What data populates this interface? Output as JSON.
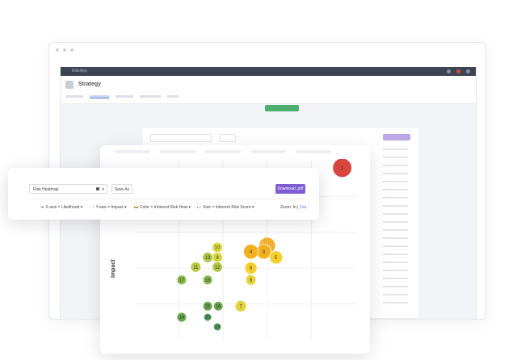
{
  "toolbar": {
    "heatmap_select": "Risk Heatmap",
    "save_as": "Save As",
    "download": "Download .pdf",
    "x_axis": "X-axis = Likelihood",
    "y_axis": "Y-axis = Impact",
    "color": "Color = Inherent Risk Heat",
    "size": "Size = Inherent Risk Score",
    "zoom_label": "Zoom:",
    "zoom_in": "In",
    "zoom_sep": "|",
    "zoom_out": "Out"
  },
  "background_window": {
    "topbar_title": "RiskApp",
    "page_title": "Strategy",
    "accent_color": "#4caf6d"
  },
  "chart_data": {
    "type": "scatter",
    "ylabel": "Impact",
    "xlabel": "",
    "grid": true,
    "x_range": [
      0,
      5
    ],
    "y_range": [
      0,
      5
    ],
    "points": [
      {
        "label": "1",
        "x": 4.7,
        "y": 4.8,
        "r": 2.2,
        "color": "#d9463f"
      },
      {
        "label": "2",
        "x": 3.0,
        "y": 2.63,
        "r": 1.9,
        "color": "#f0a92b",
        "pattern": true
      },
      {
        "label": "3",
        "x": 2.92,
        "y": 2.46,
        "r": 1.7,
        "color": "#f2b01e"
      },
      {
        "label": "4",
        "x": 2.63,
        "y": 2.46,
        "r": 1.7,
        "color": "#f2b01e"
      },
      {
        "label": "5",
        "x": 3.2,
        "y": 2.3,
        "r": 1.5,
        "color": "#f3d02c"
      },
      {
        "label": "6",
        "x": 2.63,
        "y": 2.0,
        "r": 1.4,
        "color": "#f3d02c"
      },
      {
        "label": "7",
        "x": 2.4,
        "y": 0.94,
        "r": 1.3,
        "color": "#e1d43a"
      },
      {
        "label": "8",
        "x": 2.63,
        "y": 1.67,
        "r": 1.2,
        "color": "#e8d53e"
      },
      {
        "label": "9",
        "x": 1.87,
        "y": 2.3,
        "r": 1.2,
        "color": "#d8d63f"
      },
      {
        "label": "10",
        "x": 1.87,
        "y": 2.58,
        "r": 1.2,
        "color": "#dbd941"
      },
      {
        "label": "11",
        "x": 1.38,
        "y": 2.03,
        "r": 1.2,
        "color": "#b8cc49"
      },
      {
        "label": "12",
        "x": 1.87,
        "y": 2.03,
        "r": 1.2,
        "color": "#b3cc47"
      },
      {
        "label": "13",
        "x": 1.65,
        "y": 2.3,
        "r": 1.2,
        "color": "#aec847"
      },
      {
        "label": "14",
        "x": 1.06,
        "y": 0.63,
        "r": 1.1,
        "color": "#6aa84f"
      },
      {
        "label": "15",
        "x": 1.65,
        "y": 0.94,
        "r": 1.1,
        "color": "#6aa84f"
      },
      {
        "label": "16",
        "x": 1.89,
        "y": 0.94,
        "r": 1.1,
        "color": "#6aa84f"
      },
      {
        "label": "17",
        "x": 1.06,
        "y": 1.67,
        "r": 1.1,
        "color": "#8ab94a"
      },
      {
        "label": "18",
        "x": 1.65,
        "y": 1.67,
        "r": 1.1,
        "color": "#8ab94a"
      },
      {
        "label": "19",
        "x": 1.87,
        "y": 0.36,
        "r": 0.9,
        "color": "#4e9d5a"
      },
      {
        "label": "20",
        "x": 1.65,
        "y": 0.63,
        "r": 0.9,
        "color": "#4e9d5a"
      }
    ]
  }
}
